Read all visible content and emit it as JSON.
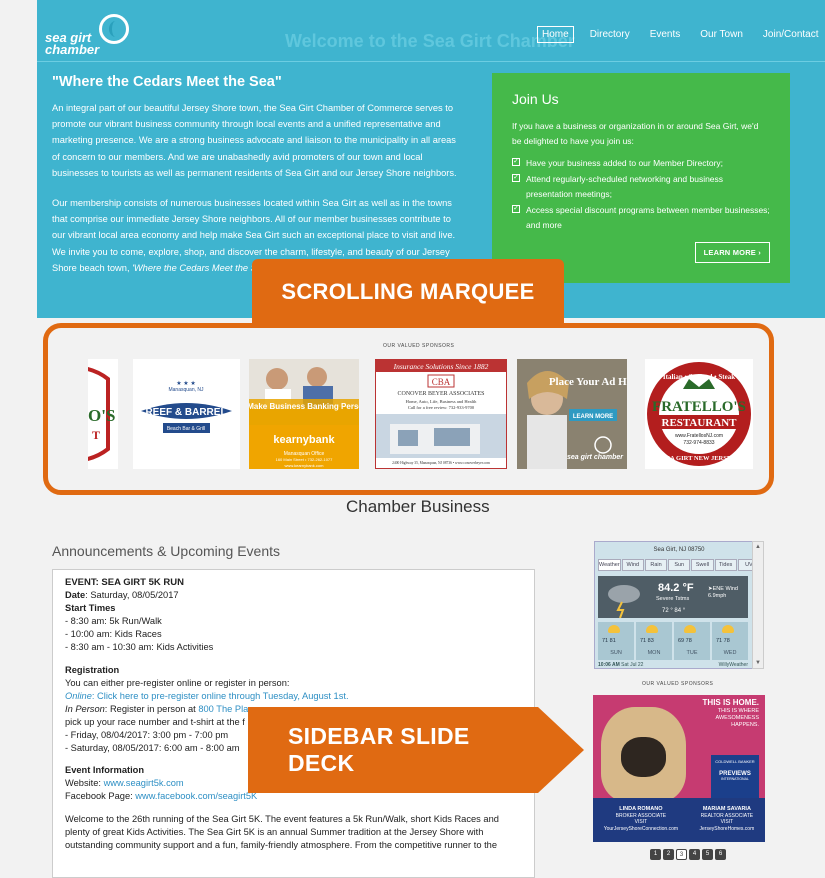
{
  "brand": {
    "logo_text": "sea girt chamber",
    "faded_title": "Welcome to the Sea Girt Chamber"
  },
  "nav": {
    "items": [
      {
        "label": "Home",
        "active": true
      },
      {
        "label": "Directory"
      },
      {
        "label": "Events"
      },
      {
        "label": "Our Town"
      },
      {
        "label": "Join/Contact"
      }
    ]
  },
  "intro": {
    "title": "\"Where the Cedars Meet the Sea\"",
    "para1": "An integral part of our beautiful Jersey Shore town, the Sea Girt Chamber of Commerce serves to promote our vibrant business community through local events and a unified representative and marketing presence.  We are a strong business advocate and liaison to the municipality in all areas of concern to our members.  And we are unabashedly avid promoters of our town and local businesses to tourists as well as permanent residents of Sea Girt and our Jersey Shore neighbors.",
    "para2": "Our membership consists of numerous businesses located within Sea Girt as well as in the towns that comprise our immediate Jersey Shore neighbors. All of our member businesses contribute to our vibrant local area economy and help make Sea Girt such an exceptional place to visit and live.  We invite you to come, explore, shop, and discover the charm, lifestyle, and beauty of our Jersey Shore beach town, ",
    "para2_italic": "'Where the Cedars Meet the S"
  },
  "join": {
    "title": "Join Us",
    "text": "If you have a business or organization in or around Sea Girt, we'd be delighted to have you join us:",
    "items": [
      "Have your business added to our Member Directory;",
      "Attend regularly-scheduled networking and business presentation meetings;",
      "Access special discount programs between member businesses; and more"
    ],
    "button": "LEARN MORE ›"
  },
  "sponsors": {
    "label": "OUR VALUED SPONSORS",
    "ads": {
      "reef_top": "Manasquan, NJ",
      "reef_name": "REEF & BARREL",
      "reef_sub": "Beach Bar & Grill",
      "kearny_head": "We Make Business Banking Personal",
      "kearny_name": "kearnybank",
      "kearny_sub": "Manasquan Office",
      "kearny_addr": "160 Main Street • 732-262-1077",
      "kearny_url": "www.kearnybank.com",
      "cba_top": "Insurance Solutions Since 1882",
      "cba_logo": "CBA",
      "cba_name": "CONOVER BEYER ASSOCIATES",
      "cba_text": "Home, Auto, Life, Business and Health",
      "cba_call": "Call for a free review: 732-933-9700",
      "cba_addr": "2400 Highway 35, Manasquan, NJ 08736 • www.conoverbeyer.com",
      "place_text": "Place Your Ad Here",
      "place_btn": "LEARN MORE",
      "place_logo": "sea girt chamber",
      "frat_arc": "Italian • Seafood • Steak",
      "frat_name": "FRATELLO'S",
      "frat_rest": "RESTAURANT",
      "frat_phone": "732-974-8833",
      "frat_url": "www.FratellosNJ.com",
      "frat_bottom": "SEA GIRT NEW JERSEY",
      "frat_left": "O'S",
      "frat_left2": "T"
    }
  },
  "callouts": {
    "marquee": "SCROLLING MARQUEE",
    "sidebar": "SIDEBAR SLIDE DECK"
  },
  "main": {
    "section_title": "Chamber Business",
    "announcements_title": "Announcements & Upcoming Events",
    "event": {
      "title": "EVENT: SEA GIRT 5K RUN",
      "date_label": "Date",
      "date_value": ": Saturday, 08/05/2017",
      "start_label": "Start Times",
      "starts": [
        "- 8:30 am: 5k Run/Walk",
        "- 10:00 am: Kids Races",
        "- 8:30 am - 10:30 am: Kids Activities"
      ],
      "reg_label": "Registration",
      "reg_text": "You can either pre-register online or register in person:",
      "online_label": "Online",
      "online_link": "Click here to pre-register online through Tuesday, August 1st.",
      "inperson_label": "In Person",
      "inperson_text": ": Register in person at ",
      "inperson_link": "800 The Pla",
      "pickup_text": "pick up your race number and t-shirt at the f",
      "pickup_lines": [
        "- Friday, 08/04/2017: 3:00 pm - 7:00 pm",
        "- Saturday, 08/05/2017: 6:00 am - 8:00 am"
      ],
      "info_label": "Event Information",
      "website_label": "Website: ",
      "website": "www.seagirt5k.com",
      "fb_label": "Facebook Page: ",
      "fb": "www.facebook.com/seagirt5K",
      "welcome": "Welcome to the 26th running of the Sea Girt 5K. The event features a 5k Run/Walk, short Kids Races and plenty of great Kids Activities. The Sea Girt 5K is an annual Summer tradition at the Jersey Shore with outstanding community support and a fun, family-friendly atmosphere. From the competitive runner to the"
    }
  },
  "sidebar": {
    "weather": {
      "location": "Sea Girt, NJ 08750",
      "tabs": [
        "Weather",
        "Wind",
        "Rain",
        "Sun",
        "Swell",
        "Tides",
        "UV"
      ],
      "temp": "84.2 °F",
      "condition": "Severe Tstms",
      "wind": "ENE Wind",
      "wind_speed": "6.9mph",
      "hilo": "72 °  84 °",
      "days": [
        {
          "name": "SUN",
          "nums": "71  81"
        },
        {
          "name": "MON",
          "nums": "71  83"
        },
        {
          "name": "TUE",
          "nums": "69  78"
        },
        {
          "name": "WED",
          "nums": "71  78"
        }
      ],
      "time": "10:06 AM",
      "date": "Sat Jul 22",
      "brand": "WillyWeather"
    },
    "sponsors_label": "OUR VALUED SPONSORS",
    "ad": {
      "tagline_head": "THIS IS HOME.",
      "tagline": "THIS IS WHERE AWESOMENESS HAPPENS.",
      "previews_top": "COLDWELL BANKER",
      "previews": "PREVIEWS",
      "previews_sub": "INTERNATIONAL",
      "agent1": "LINDA ROMANO",
      "agent1_title": "BROKER ASSOCIATE",
      "agent1_visit": "VISIT",
      "agent1_url": "YourJerseyShoreConnection.com",
      "agent2": "MARIAM SAVARIA",
      "agent2_title": "REALTOR ASSOCIATE",
      "agent2_visit": "VISIT",
      "agent2_url": "JerseyShoreHomes.com"
    },
    "slides": [
      "1",
      "2",
      "3",
      "4",
      "5",
      "6"
    ],
    "active_slide": 2
  }
}
